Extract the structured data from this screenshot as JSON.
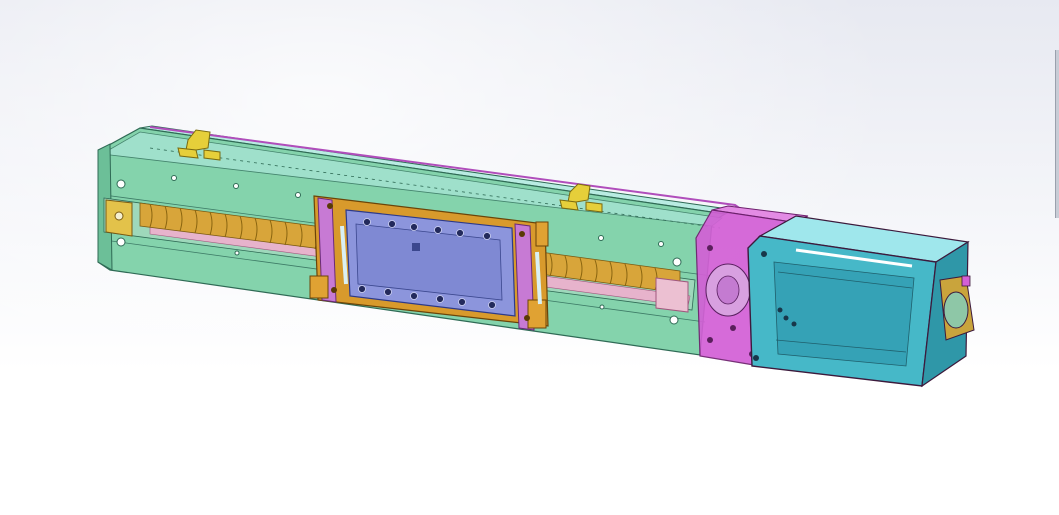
{
  "viewport": {
    "view": "isometric",
    "display_style": "shaded-with-edges-transparent"
  },
  "model": {
    "parts": [
      "aluminium-profile-body",
      "ball-screw",
      "carriage-slider",
      "carriage-top-plate",
      "sensor-brackets",
      "coupling-housing",
      "flexible-coupling",
      "servo-motor",
      "motor-end-cap"
    ]
  },
  "colors": {
    "background_top": "#e7e9f1",
    "background_bottom": "#ffffff",
    "body": "#7fcfa8",
    "body_edge": "#2f6a55",
    "body_top": "#a7e3d9",
    "screw": "#d8a53a",
    "rail_pink": "#e7b3cc",
    "carriage_frame": "#d89a2c",
    "carriage_plate": "#8c95dc",
    "carriage_side": "#c77ad4",
    "housing": "#d35fd6",
    "motor": "#3fb4c4",
    "motor_edge": "#3c1a3c",
    "bracket": "#e6cf3a"
  }
}
